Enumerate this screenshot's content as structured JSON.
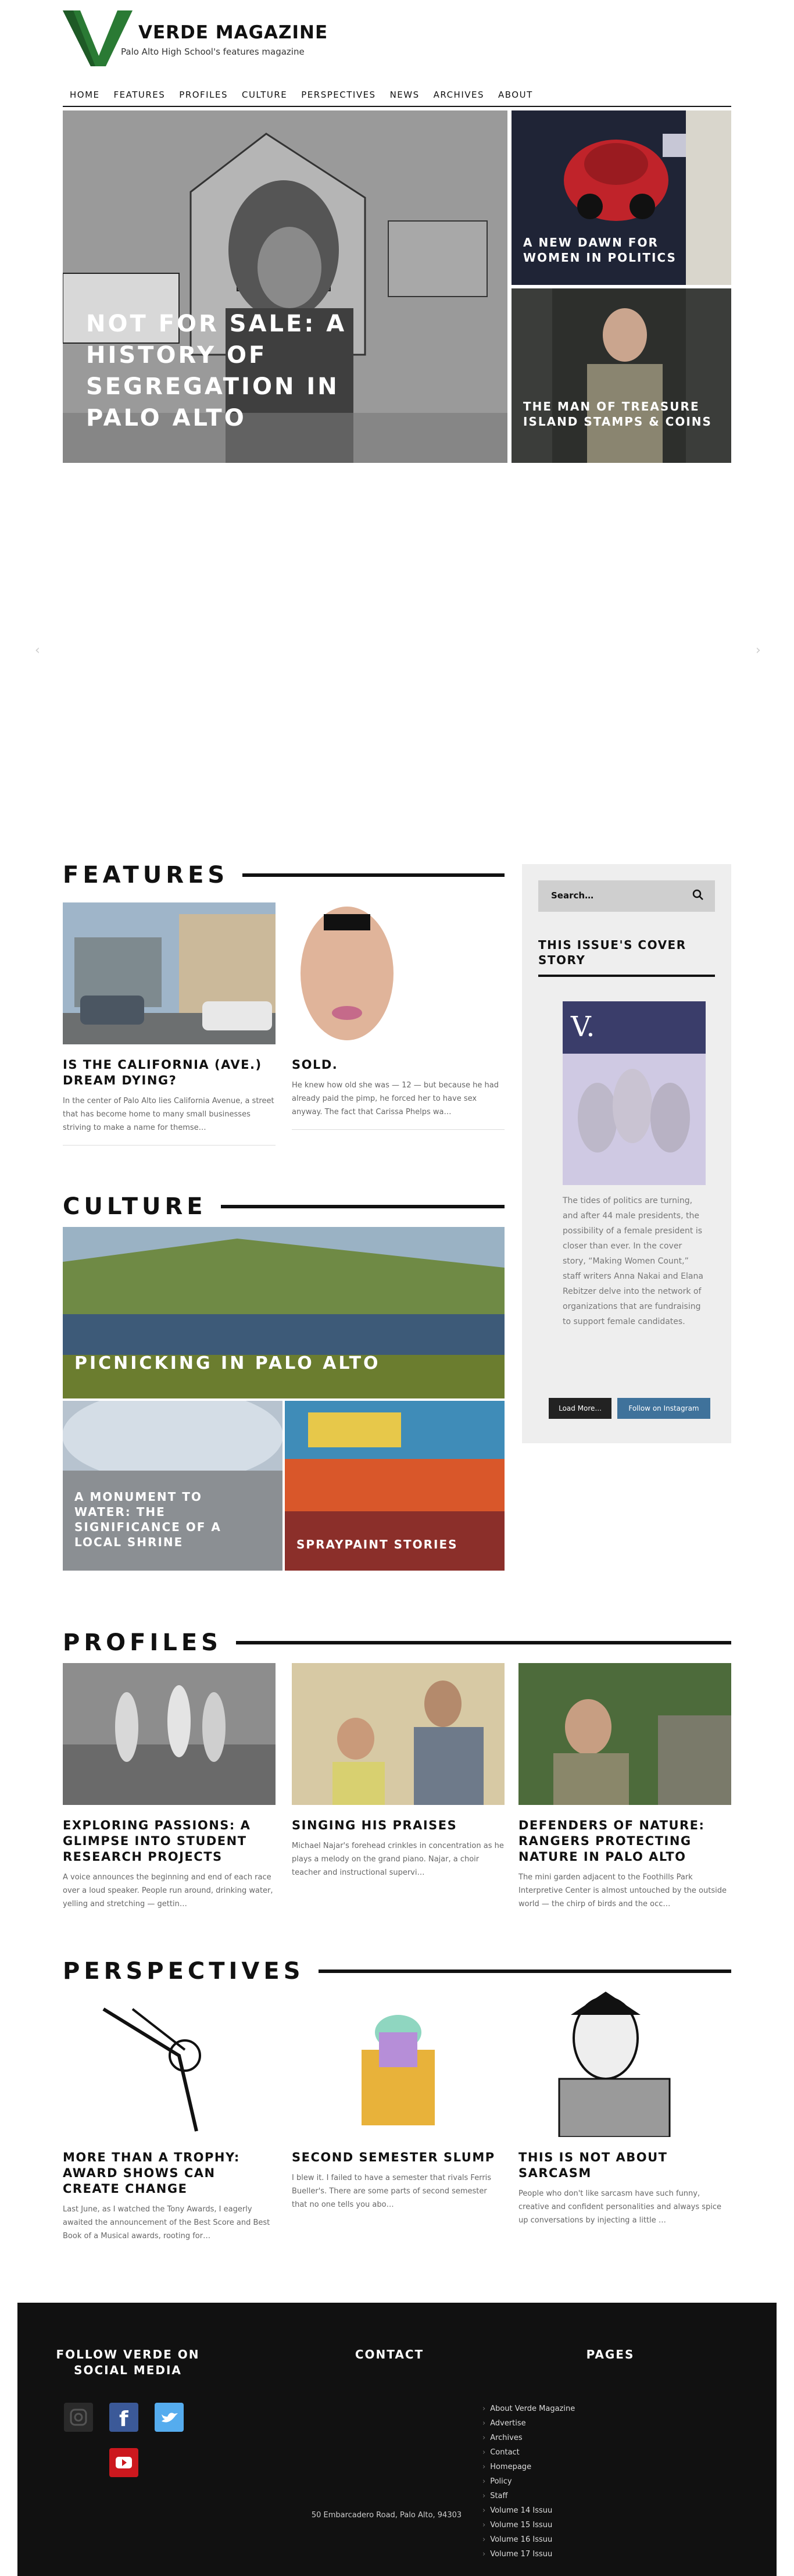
{
  "site": {
    "title": "VERDE MAGAZINE",
    "tagline": "Palo Alto High School's features magazine"
  },
  "nav": [
    "HOME",
    "FEATURES",
    "PROFILES",
    "CULTURE",
    "PERSPECTIVES",
    "NEWS",
    "ARCHIVES",
    "ABOUT"
  ],
  "hero": {
    "main_title": "NOT FOR SALE: A HISTORY OF SEGREGATION IN PALO ALTO",
    "side1_title": "A NEW DAWN FOR WOMEN IN POLITICS",
    "side2_title": "THE MAN OF TREASURE ISLAND STAMPS & COINS"
  },
  "features": {
    "heading": "FEATURES",
    "articles": [
      {
        "title": "IS THE CALIFORNIA (AVE.) DREAM DYING?",
        "excerpt": "In the center of Palo Alto lies California Avenue, a street that has become home to many small businesses striving to make a name for themse…"
      },
      {
        "title": "SOLD.",
        "excerpt": "He knew how old she was — 12 — but because he had already paid the pimp, he forced her to have sex anyway. The fact that Carissa Phelps wa…"
      }
    ]
  },
  "sidebar": {
    "search_placeholder": "Search…",
    "cover_heading": "THIS ISSUE'S COVER STORY",
    "cover_text": "The tides of politics are turning, and after 44 male presidents, the possibility of a female president is closer than ever. In the cover story, “Making Women Count,” staff writers Anna Nakai and Elana Rebitzer delve into the network of organizations that are fundraising to support female candidates.",
    "load_more": "Load More...",
    "follow_instagram": "Follow on Instagram"
  },
  "culture": {
    "heading": "CULTURE",
    "main": "PICNICKING IN PALO ALTO",
    "tile1": "A MONUMENT TO WATER: THE SIGNIFICANCE OF A LOCAL SHRINE",
    "tile2": "SPRAYPAINT STORIES"
  },
  "profiles": {
    "heading": "PROFILES",
    "articles": [
      {
        "title": "EXPLORING PASSIONS: A GLIMPSE INTO STUDENT RESEARCH PROJECTS",
        "excerpt": "A voice announces the beginning and end of each race over a loud speaker. People run around, drinking water, yelling and stretching — gettin…"
      },
      {
        "title": "SINGING HIS PRAISES",
        "excerpt": "Michael Najar's forehead crinkles in concentration as he plays a melody on the grand piano. Najar, a choir teacher and instructional supervi…"
      },
      {
        "title": "DEFENDERS OF NATURE: RANGERS PROTECTING NATURE IN PALO ALTO",
        "excerpt": "The mini garden adjacent to the Foothills Park Interpretive Center is almost untouched by the outside world — the chirp of birds and the occ…"
      }
    ]
  },
  "perspectives": {
    "heading": "PERSPECTIVES",
    "articles": [
      {
        "title": "MORE THAN A TROPHY: AWARD SHOWS CAN CREATE CHANGE",
        "excerpt": "Last June, as I watched the Tony Awards, I eagerly awaited the announcement of the Best Score and Best Book of a Musical awards, rooting for…"
      },
      {
        "title": "SECOND SEMESTER SLUMP",
        "excerpt": "I blew it. I failed to have a semester that rivals Ferris Bueller's. There are some parts of second semester that no one tells you abo…"
      },
      {
        "title": "THIS IS NOT ABOUT SARCASM",
        "excerpt": "People who don't like sarcasm have such funny, creative and confident personalities and always spice up conversations by injecting a little …"
      }
    ]
  },
  "footer": {
    "social_heading": "FOLLOW VERDE ON SOCIAL MEDIA",
    "contact_heading": "CONTACT",
    "pages_heading": "PAGES",
    "address": "50 Embarcadero Road, Palo Alto, 94303",
    "pages": [
      "About Verde Magazine",
      "Advertise",
      "Archives",
      "Contact",
      "Homepage",
      "Policy",
      "Staff",
      "Volume 14 Issuu",
      "Volume 15 Issuu",
      "Volume 16 Issuu",
      "Volume 17 Issuu"
    ]
  },
  "colors": {
    "brand_green": "#1f6b2a",
    "instagram_blue": "#3f729b",
    "facebook": "#3b5998",
    "twitter": "#55acee",
    "youtube": "#cc181e"
  }
}
